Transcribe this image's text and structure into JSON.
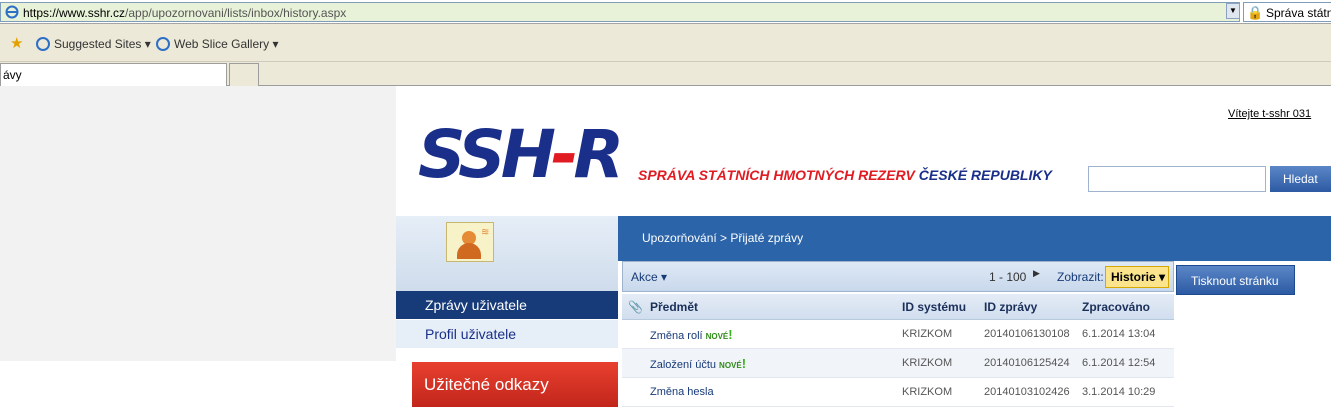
{
  "browser": {
    "url_prefix": "https://www.sshr.cz",
    "url_rest": "/app/upozornovani/lists/inbox/history.aspx",
    "cert_label": "Správa státní",
    "favorites": [
      "Suggested Sites",
      "Web Slice Gallery"
    ],
    "tab_title": "ávy"
  },
  "site": {
    "logo_left": "SSH",
    "logo_dash": "-",
    "logo_right": "R",
    "tagline_red": "SPRÁVA STÁTNÍCH HMOTNÝCH REZERV",
    "tagline_blue": "ČESKÉ REPUBLIKY",
    "welcome": "Vítejte t-sshr 031",
    "search_button": "Hledat"
  },
  "nav": {
    "items": [
      "Zprávy uživatele",
      "Profil uživatele"
    ],
    "useful_links": "Užitečné odkazy"
  },
  "main": {
    "breadcrumb": "Upozorňování > Přijaté zprávy",
    "actions": "Akce",
    "range": "1 - 100",
    "show_label": "Zobrazit:",
    "view": "Historie",
    "print_button": "Tisknout stránku",
    "columns": [
      "Předmět",
      "ID systému",
      "ID zprávy",
      "Zpracováno"
    ],
    "rows": [
      {
        "subject": "Změna rolí",
        "new": "NOVÉ",
        "system": "KRIZKOM",
        "id": "20140106130108",
        "date": "6.1.2014 13:04"
      },
      {
        "subject": "Založení účtu",
        "new": "NOVÉ",
        "system": "KRIZKOM",
        "id": "20140106125424",
        "date": "6.1.2014 12:54"
      },
      {
        "subject": "Změna hesla",
        "new": "",
        "system": "KRIZKOM",
        "id": "20140103102426",
        "date": "3.1.2014 10:29"
      }
    ]
  }
}
